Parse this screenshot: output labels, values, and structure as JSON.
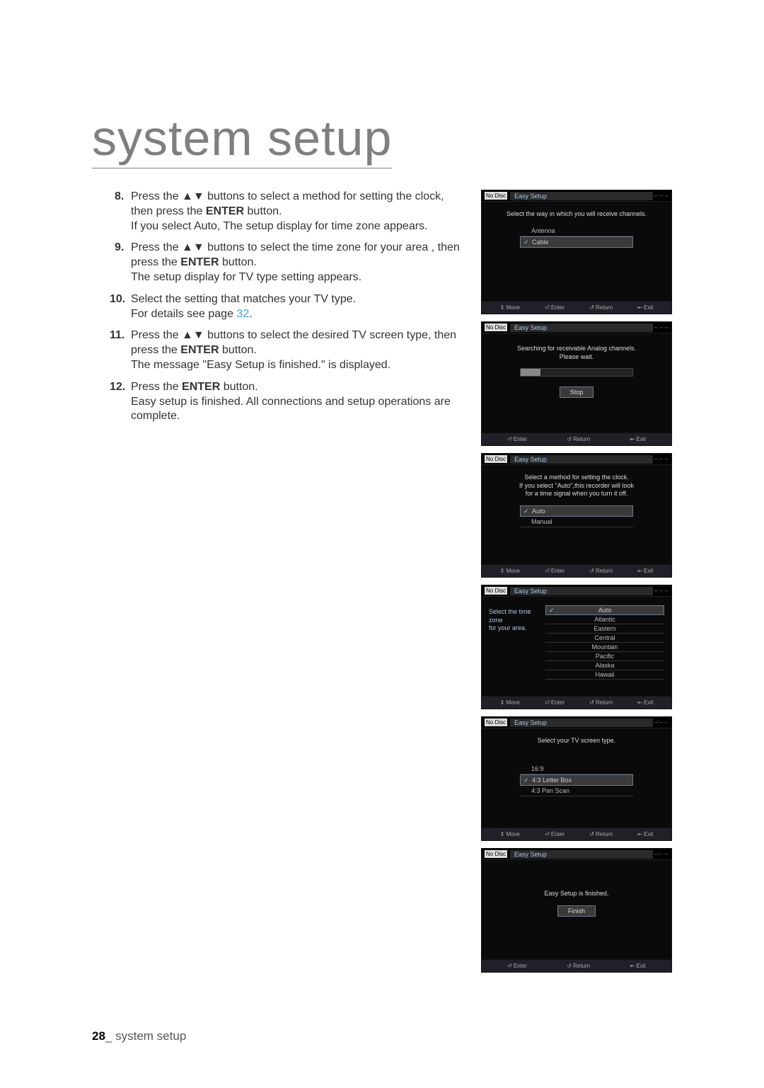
{
  "page": {
    "title": "system setup",
    "footer_page": "28",
    "footer_sep": "_",
    "footer_label": "system setup"
  },
  "steps": [
    {
      "num": "8.",
      "text_before_arrows": "Press the ",
      "arrows": "▲▼",
      "text_mid": " buttons to select a method for setting the clock, then press the ",
      "bold": "ENTER",
      "text_after": " button.",
      "line2": "If you select Auto, The setup display for time zone appears."
    },
    {
      "num": "9.",
      "text_before_arrows": " Press the ",
      "arrows": "▲▼",
      "text_mid": " buttons to select the time zone for your area , then press the ",
      "bold": "ENTER",
      "text_after": " button.",
      "line2": "The setup display for TV type setting appears."
    },
    {
      "num": "10.",
      "text_mid": "Select the setting that matches your TV type.",
      "line2_a": "For details see page ",
      "page_ref": "32",
      "line2_b": "."
    },
    {
      "num": "11.",
      "text_before_arrows": "Press the ",
      "arrows": "▲▼",
      "text_mid": " buttons to select the desired TV screen type, then press the ",
      "bold": "ENTER",
      "text_after": " button.",
      "line2": "The message \"Easy Setup is finished.\" is displayed."
    },
    {
      "num": "12.",
      "text_before": "Press the ",
      "bold": "ENTER",
      "text_after": " button.",
      "line2": "Easy setup is finished. All connections and setup operations are complete."
    }
  ],
  "common": {
    "nodisc": "No Disc",
    "easy_setup": "Easy Setup",
    "timecode": "--:-- --",
    "move": "Move",
    "enter": "Enter",
    "return": "Return",
    "exit": "Exit"
  },
  "screens": {
    "s1": {
      "msg": "Select the way in which you will receive channels.",
      "opts": [
        "Antenna",
        "Cable"
      ],
      "selected": 1
    },
    "s2": {
      "msg_l1": "Searching for receivable Analog channels.",
      "msg_l2": "Please wait.",
      "stop": "Stop"
    },
    "s3": {
      "msg_l1": "Select a method for setting the clock.",
      "msg_l2": "If you select \"Auto\",this recorder will look",
      "msg_l3": "for a time signal when you turn it off.",
      "opts": [
        "Auto",
        "Manual"
      ],
      "selected": 0
    },
    "s4": {
      "label_l1": "Select the time zone",
      "label_l2": "for your area.",
      "opts": [
        "Auto",
        "Atlantic",
        "Eastern",
        "Central",
        "Mountain",
        "Pacific",
        "Alaska",
        "Hawaii"
      ],
      "selected": 0
    },
    "s5": {
      "msg": "Select your TV screen type.",
      "opts": [
        "16:9",
        "4:3 Letter Box",
        "4:3 Pan Scan"
      ],
      "selected": 1
    },
    "s6": {
      "msg": "Easy Setup is finished.",
      "finish": "Finish"
    }
  }
}
